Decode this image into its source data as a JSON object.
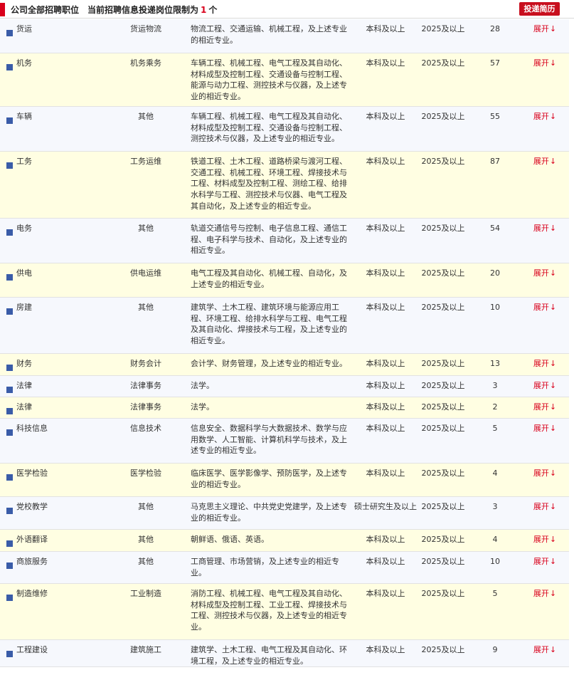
{
  "header": {
    "title": "公司全部招聘职位",
    "notice_prefix": "当前招聘信息投递岗位限制为",
    "limit_count": "1",
    "notice_suffix": "个",
    "apply_button": "投递简历"
  },
  "expand_label": "展开",
  "expand_arrow": "↓",
  "rows": [
    {
      "name": "货运",
      "category": "货运物流",
      "majors": "物流工程、交通运输、机械工程，及上述专业的相近专业。",
      "education": "本科及以上",
      "year": "2025及以上",
      "count": "28"
    },
    {
      "name": "机务",
      "category": "机务乘务",
      "majors": "车辆工程、机械工程、电气工程及其自动化、材料成型及控制工程、交通设备与控制工程、能源与动力工程、测控技术与仪器，及上述专业的相近专业。",
      "education": "本科及以上",
      "year": "2025及以上",
      "count": "57"
    },
    {
      "name": "车辆",
      "category": "其他",
      "majors": "车辆工程、机械工程、电气工程及其自动化、材料成型及控制工程、交通设备与控制工程、测控技术与仪器，及上述专业的相近专业。",
      "education": "本科及以上",
      "year": "2025及以上",
      "count": "55"
    },
    {
      "name": "工务",
      "category": "工务运维",
      "majors": "铁道工程、土木工程、道路桥梁与渡河工程、交通工程、机械工程、环境工程、焊接技术与工程、材料成型及控制工程、测绘工程、给排水科学与工程、测控技术与仪器、电气工程及其自动化，及上述专业的相近专业。",
      "education": "本科及以上",
      "year": "2025及以上",
      "count": "87"
    },
    {
      "name": "电务",
      "category": "其他",
      "majors": "轨道交通信号与控制、电子信息工程、通信工程、电子科学与技术、自动化，及上述专业的相近专业。",
      "education": "本科及以上",
      "year": "2025及以上",
      "count": "54"
    },
    {
      "name": "供电",
      "category": "供电运维",
      "majors": "电气工程及其自动化、机械工程、自动化，及上述专业的相近专业。",
      "education": "本科及以上",
      "year": "2025及以上",
      "count": "20"
    },
    {
      "name": "房建",
      "category": "其他",
      "majors": "建筑学、土木工程、建筑环境与能源应用工程、环境工程、给排水科学与工程、电气工程及其自动化、焊接技术与工程，及上述专业的相近专业。",
      "education": "本科及以上",
      "year": "2025及以上",
      "count": "10"
    },
    {
      "name": "财务",
      "category": "财务会计",
      "majors": "会计学、财务管理，及上述专业的相近专业。",
      "education": "本科及以上",
      "year": "2025及以上",
      "count": "13"
    },
    {
      "name": "法律",
      "category": "法律事务",
      "majors": "法学。",
      "education": "本科及以上",
      "year": "2025及以上",
      "count": "3"
    },
    {
      "name": "法律",
      "category": "法律事务",
      "majors": "法学。",
      "education": "本科及以上",
      "year": "2025及以上",
      "count": "2"
    },
    {
      "name": "科技信息",
      "category": "信息技术",
      "majors": "信息安全、数据科学与大数据技术、数学与应用数学、人工智能、计算机科学与技术，及上述专业的相近专业。",
      "education": "本科及以上",
      "year": "2025及以上",
      "count": "5"
    },
    {
      "name": "医学检验",
      "category": "医学检验",
      "majors": "临床医学、医学影像学、预防医学，及上述专业的相近专业。",
      "education": "本科及以上",
      "year": "2025及以上",
      "count": "4"
    },
    {
      "name": "党校教学",
      "category": "其他",
      "majors": "马克思主义理论、中共党史党建学，及上述专业的相近专业。",
      "education": "硕士研究生及以上",
      "year": "2025及以上",
      "count": "3"
    },
    {
      "name": "外语翻译",
      "category": "其他",
      "majors": "朝鲜语、俄语、英语。",
      "education": "本科及以上",
      "year": "2025及以上",
      "count": "4"
    },
    {
      "name": "商旅服务",
      "category": "其他",
      "majors": "工商管理、市场营销，及上述专业的相近专业。",
      "education": "本科及以上",
      "year": "2025及以上",
      "count": "10"
    },
    {
      "name": "制造维修",
      "category": "工业制造",
      "majors": "消防工程、机械工程、电气工程及其自动化、材料成型及控制工程、工业工程、焊接技术与工程、测控技术与仪器，及上述专业的相近专业。",
      "education": "本科及以上",
      "year": "2025及以上",
      "count": "5"
    },
    {
      "name": "工程建设",
      "category": "建筑施工",
      "majors": "建筑学、土木工程、电气工程及其自动化、环境工程，及上述专业的相近专业。",
      "education": "本科及以上",
      "year": "2025及以上",
      "count": "9"
    }
  ]
}
